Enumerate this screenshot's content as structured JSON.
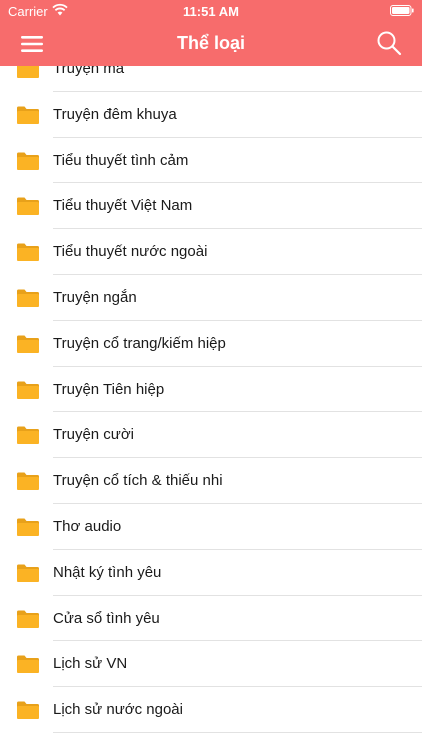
{
  "status_bar": {
    "carrier": "Carrier",
    "time": "11:51 AM"
  },
  "nav": {
    "title": "Thể loại",
    "menu_icon": "hamburger-icon",
    "search_icon": "search-icon"
  },
  "colors": {
    "accent": "#f76c6c",
    "folder": "#fbb324"
  },
  "categories": [
    "Truyện ma",
    "Truyện đêm khuya",
    "Tiểu thuyết tình cảm",
    "Tiểu thuyết Việt Nam",
    "Tiểu thuyết nước ngoài",
    "Truyện ngắn",
    "Truyện cổ trang/kiếm hiệp",
    "Truyện Tiên hiệp",
    "Truyện cười",
    "Truyện cổ tích & thiếu nhi",
    "Thơ audio",
    "Nhật ký tình yêu",
    "Cửa sổ tình yêu",
    "Lịch sử VN",
    "Lịch sử nước ngoài"
  ]
}
